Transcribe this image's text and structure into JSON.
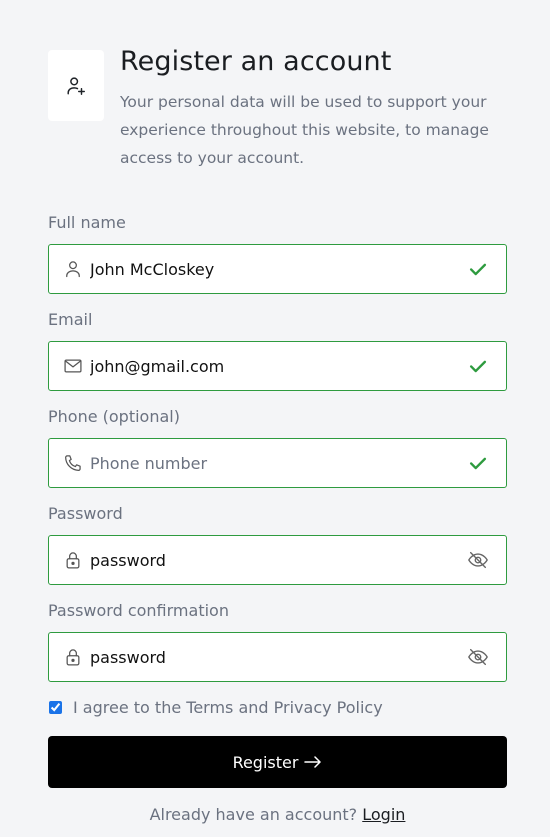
{
  "header": {
    "icon": "user-plus-icon",
    "title": "Register an account",
    "subtitle": "Your personal data will be used to support your experience throughout this website, to manage access to your account."
  },
  "form": {
    "full_name": {
      "label": "Full name",
      "value": "John McCloskey",
      "placeholder": "",
      "icon": "user-icon",
      "status_icon": "check-icon",
      "valid": true
    },
    "email": {
      "label": "Email",
      "value": "john@gmail.com",
      "placeholder": "",
      "icon": "mail-icon",
      "status_icon": "check-icon",
      "valid": true
    },
    "phone": {
      "label": "Phone (optional)",
      "value": "",
      "placeholder": "Phone number",
      "icon": "phone-icon",
      "status_icon": "check-icon",
      "valid": true
    },
    "password": {
      "label": "Password",
      "value": "password",
      "icon": "lock-icon",
      "toggle_icon": "eye-off-icon"
    },
    "password_confirmation": {
      "label": "Password confirmation",
      "value": "password",
      "icon": "lock-icon",
      "toggle_icon": "eye-off-icon"
    },
    "agree": {
      "checked": true,
      "label": "I agree to the Terms and Privacy Policy"
    },
    "register_label": "Register",
    "register_icon": "arrow-right-icon"
  },
  "footer": {
    "prompt": "Already have an account?",
    "login_label": "Login"
  },
  "colors": {
    "valid_border": "#2e9b3f",
    "check": "#2e9b3f",
    "button_bg": "#000000",
    "background": "#f4f5f7"
  }
}
